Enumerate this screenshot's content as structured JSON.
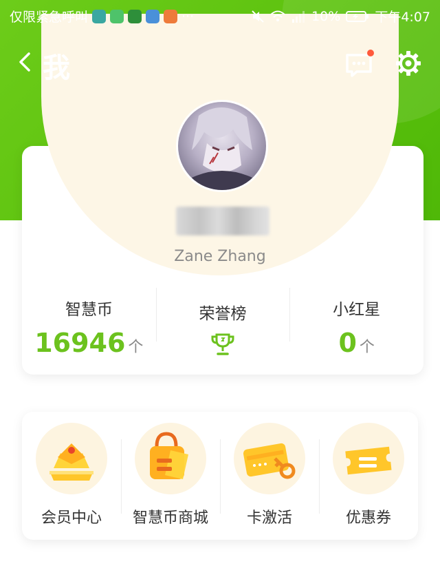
{
  "status_bar": {
    "carrier": "仅限紧急呼叫",
    "dots": "···",
    "battery": "10%",
    "time": "下午4:07"
  },
  "header": {
    "title": "我",
    "back_icon": "chevron-left-icon",
    "message_icon": "message-icon",
    "settings_icon": "gear-icon"
  },
  "profile": {
    "username": "Zane Zhang"
  },
  "stats": [
    {
      "label": "智慧币",
      "value": "16946",
      "unit": "个"
    },
    {
      "label": "荣誉榜",
      "icon": "trophy-icon"
    },
    {
      "label": "小红星",
      "value": "0",
      "unit": "个"
    }
  ],
  "menu": [
    {
      "label": "会员中心",
      "icon": "crown-icon"
    },
    {
      "label": "智慧币商城",
      "icon": "shopping-bag-icon"
    },
    {
      "label": "卡激活",
      "icon": "card-key-icon"
    },
    {
      "label": "优惠券",
      "icon": "coupon-icon"
    }
  ],
  "colors": {
    "brand_green": "#5cc20e",
    "value_green": "#6cc21e",
    "cream": "#fdf6e6",
    "badge_red": "#ff5a3c"
  }
}
